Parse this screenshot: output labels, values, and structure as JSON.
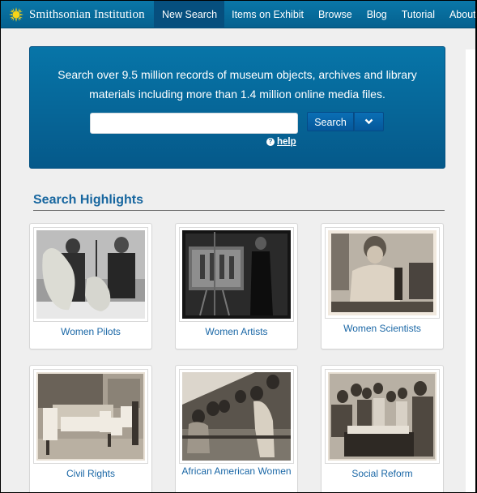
{
  "header": {
    "logo_text": "Smithsonian Institution",
    "logo_icon": "sun-icon",
    "nav": [
      {
        "label": "New Search",
        "active": true
      },
      {
        "label": "Items on Exhibit",
        "active": false
      },
      {
        "label": "Browse",
        "active": false
      },
      {
        "label": "Blog",
        "active": false
      },
      {
        "label": "Tutorial",
        "active": false
      },
      {
        "label": "About",
        "active": false
      }
    ]
  },
  "search": {
    "intro_line1": "Search over 9.5 million records of museum objects, archives and library",
    "intro_line2": "materials including more than 1.4 million online media files.",
    "input_value": "",
    "input_placeholder": "",
    "button_label": "Search",
    "dropdown_icon": "chevron-down-icon",
    "help_label": " help",
    "help_icon": "question-circle-icon"
  },
  "highlights": {
    "title": "Search Highlights",
    "cards": [
      {
        "label": "Women Pilots"
      },
      {
        "label": "Women Artists"
      },
      {
        "label": "Women Scientists"
      },
      {
        "label": "Civil Rights"
      },
      {
        "label": "African American Women"
      },
      {
        "label": "Social Reform"
      }
    ]
  },
  "colors": {
    "nav_bg": "#0a77a8",
    "nav_active": "#064f7e",
    "panel_bg": "#0775a8",
    "heading": "#17669f",
    "link": "#1a67a6",
    "page_bg": "#efefef"
  }
}
